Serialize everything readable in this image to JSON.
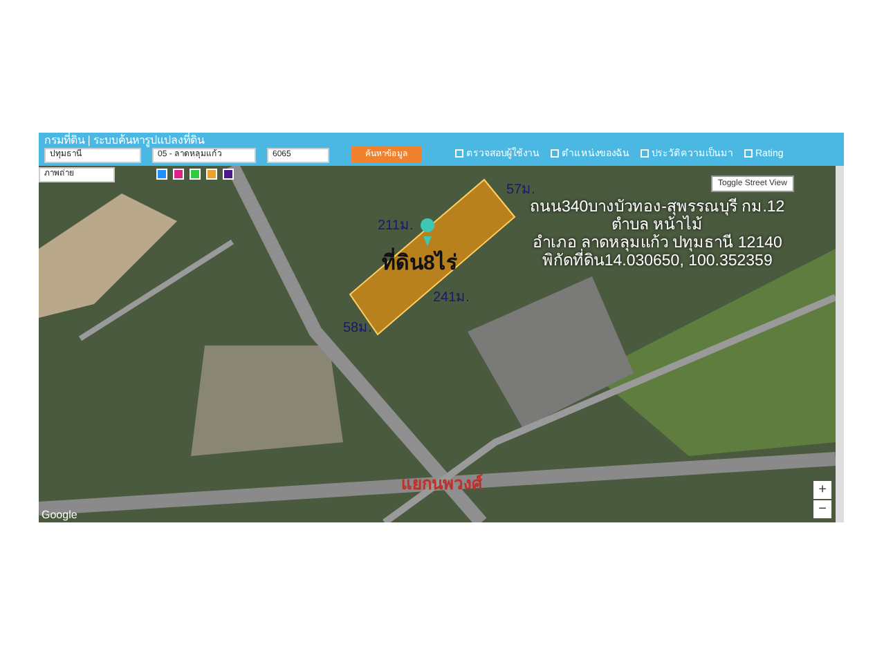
{
  "header": {
    "title": "กรมที่ดิน | ระบบค้นหารูปแปลงที่ดิน",
    "province": "ปทุมธานี",
    "district": "05 - ลาดหลุมแก้ว",
    "parcel_number": "6065",
    "search_button": "ค้นหาข้อมูล",
    "options": [
      {
        "label": "ตรวจสอบผู้ใช้งาน",
        "checked": false
      },
      {
        "label": "ตำแหน่งของฉัน",
        "checked": false
      },
      {
        "label": "ประวัติความเป็นมา",
        "checked": false
      },
      {
        "label": "Rating",
        "checked": false
      }
    ]
  },
  "map": {
    "map_type": "ภาพถ่าย",
    "swatches": [
      {
        "color": "#1e90ff",
        "selected": false
      },
      {
        "color": "#e0208a",
        "selected": false
      },
      {
        "color": "#2ecc40",
        "selected": false
      },
      {
        "color": "#f0a030",
        "selected": false
      },
      {
        "color": "#4b1a8a",
        "selected": false
      }
    ],
    "street_view_button": "Toggle Street View",
    "plot": {
      "label": "ที่ดิน8ไร่",
      "sides": [
        "57ม.",
        "211ม.",
        "241ม.",
        "58ม."
      ]
    },
    "address_lines": [
      "ถนน340บางบัวทอง-สุพรรณบุรี กม.12",
      "ตำบล หน้าไม้",
      "อำเภอ ลาดหลุมแก้ว ปทุมธานี 12140",
      "พิกัดที่ดิน14.030650, 100.352359"
    ],
    "junction_label": "แยกนพวงศ์",
    "logo": "Google",
    "zoom_in": "+",
    "zoom_out": "−"
  }
}
